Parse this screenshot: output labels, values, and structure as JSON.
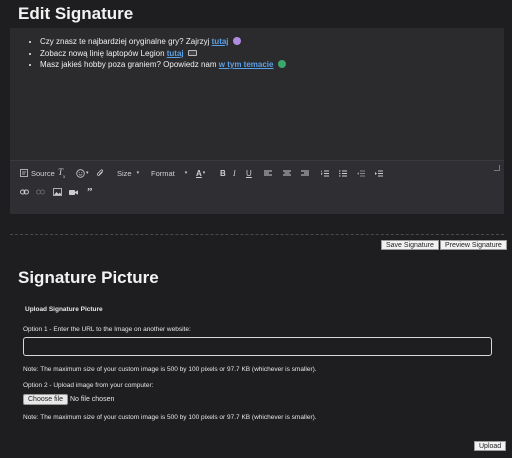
{
  "edit_signature": {
    "title": "Edit Signature",
    "lines": [
      {
        "text": "Czy znasz te najbardziej oryginalne gry? Zajrzyj ",
        "link": "tutaj",
        "emoji": "purple-orb-emoji"
      },
      {
        "text": "Zobacz nową linię laptopów Legion ",
        "link": "tutaj",
        "emoji": "laptop-emoji"
      },
      {
        "text": "Masz jakieś hobby poza graniem? Opowiedz nam ",
        "link": "w tym temacie",
        "emoji": "green-orb-emoji"
      }
    ],
    "toolbar": {
      "source_label": "Source",
      "size_label": "Size",
      "format_label": "Format"
    },
    "save_label": "Save Signature",
    "preview_label": "Preview Signature"
  },
  "signature_picture": {
    "title": "Signature Picture",
    "upload_heading": "Upload Signature Picture",
    "option1_label": "Option 1 - Enter the URL to the Image on another website:",
    "url_value": "",
    "note1": "Note: The maximum size of your custom image is 500 by 100 pixels or 97.7 KB (whichever is smaller).",
    "option2_label": "Option 2 - Upload image from your computer:",
    "choose_file_label": "Choose file",
    "no_file_label": "No file chosen",
    "note2": "Note: The maximum size of your custom image is 500 by 100 pixels or 97.7 KB (whichever is smaller).",
    "upload_label": "Upload"
  },
  "colors": {
    "background": "#1e1e20",
    "editor": "#2b2b2e",
    "toolbar": "#2f2f33",
    "link": "#5aa0e6"
  }
}
